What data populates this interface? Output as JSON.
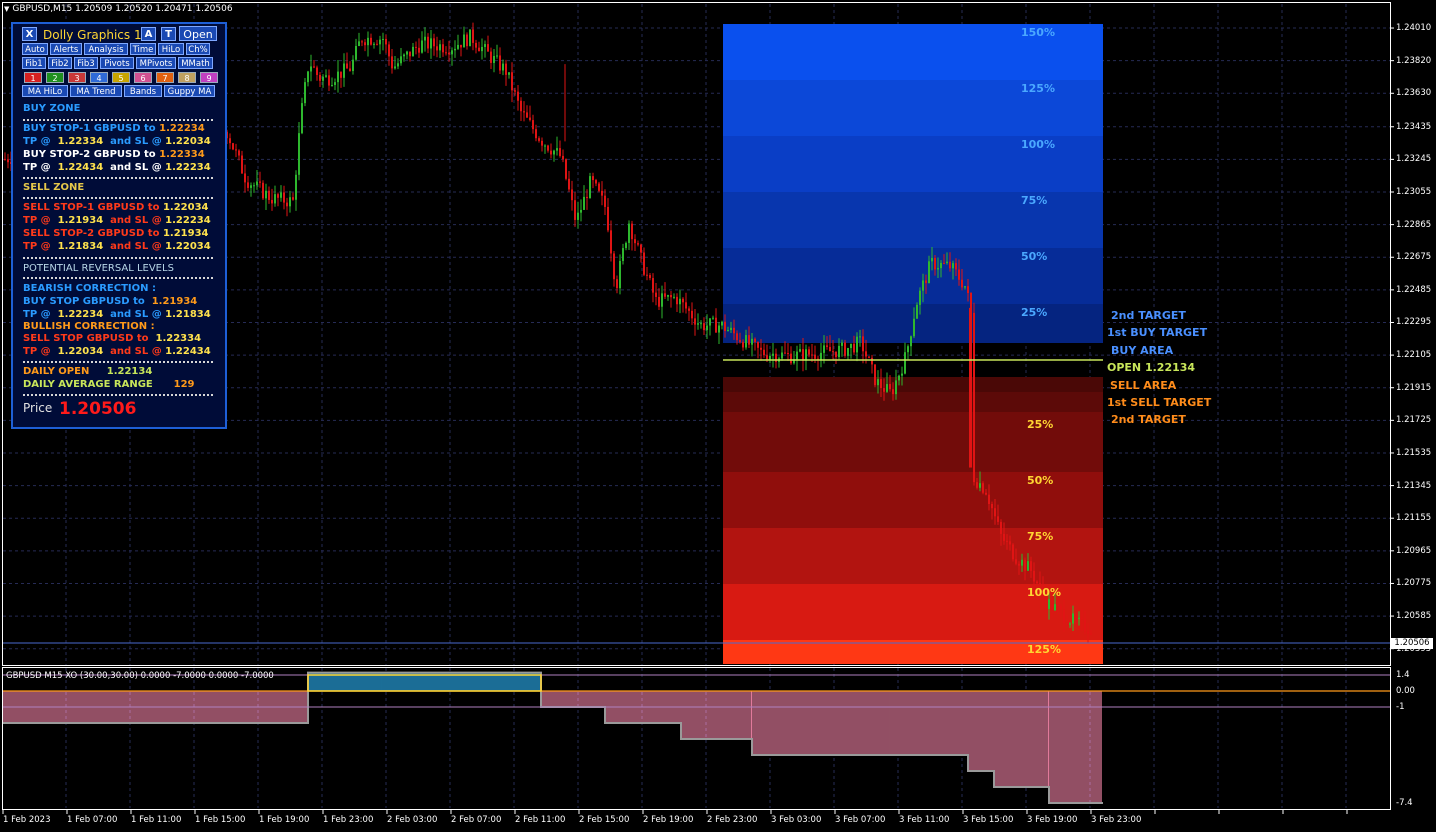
{
  "titlebar": {
    "text": "GBPUSD,M15  1.20509 1.20520 1.20471 1.20506"
  },
  "colors": {
    "bull": "#2eb82e",
    "bear": "#e01414",
    "grid": "#2a2f5a",
    "axis": "#ffffff",
    "open_line": "#c8e65a"
  },
  "panel": {
    "close": "X",
    "title": "Dolly Graphics 18",
    "a_btn": "A",
    "t_btn": "T",
    "open_btn": "Open",
    "row1": [
      "Auto",
      "Alerts",
      "Analysis",
      "Time",
      "HiLo",
      "Ch%"
    ],
    "row2": [
      "Fib1",
      "Fib2",
      "Fib3",
      "Pivots",
      "MPivots",
      "MMath"
    ],
    "row3": [
      "1",
      "2",
      "3",
      "4",
      "5",
      "6",
      "7",
      "8",
      "9"
    ],
    "row3_colors": [
      "#d62020",
      "#1f8f1f",
      "#c83838",
      "#2f6ad8",
      "#c8a400",
      "#d05090",
      "#e06010",
      "#c0a060",
      "#c040c0"
    ],
    "row4": [
      "MA HiLo",
      "MA Trend",
      "Bands",
      "Guppy MA"
    ],
    "buy_zone": "BUY ZONE",
    "buy_stop1_a": "BUY STOP-1  GBPUSD  to",
    "buy_stop1_b": "1.22234",
    "tp1_a": "TP @",
    "tp1_b": "1.22334",
    "tp1_c": "and  SL @",
    "tp1_d": "1.22034",
    "buy_stop2_a": "BUY STOP-2  GBPUSD  to",
    "buy_stop2_b": "1.22334",
    "tp2_a": "TP @",
    "tp2_b": "1.22434",
    "tp2_c": "and  SL @",
    "tp2_d": "1.22234",
    "sell_zone": "SELL ZONE",
    "sell_stop1_a": "SELL STOP-1  GBPUSD to",
    "sell_stop1_b": "1.22034",
    "stp1_a": "TP @",
    "stp1_b": "1.21934",
    "stp1_c": "and  SL @",
    "stp1_d": "1.22234",
    "sell_stop2_a": "SELL STOP-2  GBPUSD to",
    "sell_stop2_b": "1.21934",
    "stp2_a": "TP @",
    "stp2_b": "1.21834",
    "stp2_c": "and  SL @",
    "stp2_d": "1.22034",
    "potential": "POTENTIAL REVERSAL LEVELS",
    "bearish": "BEARISH CORRECTION :",
    "bear_buy_a": "BUY STOP GBPUSD  to",
    "bear_buy_b": "1.21934",
    "btp_a": "TP @",
    "btp_b": "1.22234",
    "btp_c": "and  SL @",
    "btp_d": "1.21834",
    "bullish": "BULLISH CORRECTION :",
    "bull_sell_a": "SELL STOP GBPUSD  to",
    "bull_sell_b": "1.22334",
    "ltp_a": "TP @",
    "ltp_b": "1.22034",
    "ltp_c": "and  SL @",
    "ltp_d": "1.22434",
    "daily_open_label": "DAILY OPEN",
    "daily_open_value": "1.22134",
    "dar_label": "DAILY AVERAGE RANGE",
    "dar_value": "129",
    "price_label": "Price",
    "price_value": "1.20506"
  },
  "zones": {
    "upper_levels": [
      "150%",
      "125%",
      "100%",
      "75%",
      "50%",
      "25%"
    ],
    "lower_levels": [
      "25%",
      "50%",
      "75%",
      "100%",
      "125%"
    ],
    "right_labels": {
      "buy_2nd": "2nd TARGET",
      "buy_1st": "1st BUY TARGET",
      "buy_area": "BUY AREA",
      "open": "OPEN 1.22134",
      "sell_area": "SELL AREA",
      "sell_1st": "1st SELL TARGET",
      "sell_2nd": "2nd TARGET"
    }
  },
  "price_axis": [
    "1.24010",
    "1.23820",
    "1.23630",
    "1.23435",
    "1.23245",
    "1.23055",
    "1.22865",
    "1.22675",
    "1.22485",
    "1.22295",
    "1.22105",
    "1.21915",
    "1.21725",
    "1.21535",
    "1.21345",
    "1.21155",
    "1.20965",
    "1.20775",
    "1.20585",
    "1.20395"
  ],
  "current_price_tag": "1.20506",
  "time_axis": [
    "1 Feb 2023",
    "1 Feb 07:00",
    "1 Feb 11:00",
    "1 Feb 15:00",
    "1 Feb 19:00",
    "1 Feb 23:00",
    "2 Feb 03:00",
    "2 Feb 07:00",
    "2 Feb 11:00",
    "2 Feb 15:00",
    "2 Feb 19:00",
    "2 Feb 23:00",
    "3 Feb 03:00",
    "3 Feb 07:00",
    "3 Feb 11:00",
    "3 Feb 15:00",
    "3 Feb 19:00",
    "3 Feb 23:00"
  ],
  "indicator": {
    "label": "GBPUSD M15 XO (30.00,30.00) 0.0000 -7.0000 0.0000 -7.0000",
    "axis": [
      "1.4",
      "0.00",
      "-1",
      "-7.4"
    ]
  },
  "chart_data": {
    "type": "candlestick",
    "symbol": "GBPUSD",
    "timeframe": "M15",
    "ylim": [
      1.203,
      1.2415
    ],
    "path": [
      [
        0,
        1.2324
      ],
      [
        30,
        1.2329
      ],
      [
        60,
        1.2318
      ],
      [
        90,
        1.2326
      ],
      [
        130,
        1.2317
      ],
      [
        170,
        1.2325
      ],
      [
        200,
        1.2334
      ],
      [
        225,
        1.2342
      ],
      [
        245,
        1.2313
      ],
      [
        270,
        1.2302
      ],
      [
        292,
        1.23
      ],
      [
        300,
        1.235
      ],
      [
        308,
        1.2382
      ],
      [
        318,
        1.2372
      ],
      [
        330,
        1.2372
      ],
      [
        350,
        1.2378
      ],
      [
        360,
        1.2395
      ],
      [
        382,
        1.2395
      ],
      [
        392,
        1.2378
      ],
      [
        420,
        1.2392
      ],
      [
        450,
        1.239
      ],
      [
        470,
        1.2396
      ],
      [
        490,
        1.2384
      ],
      [
        505,
        1.2376
      ],
      [
        520,
        1.2352
      ],
      [
        540,
        1.2336
      ],
      [
        560,
        1.2326
      ],
      [
        575,
        1.2288
      ],
      [
        590,
        1.2312
      ],
      [
        605,
        1.2296
      ],
      [
        615,
        1.225
      ],
      [
        628,
        1.2288
      ],
      [
        640,
        1.2266
      ],
      [
        655,
        1.2242
      ],
      [
        675,
        1.2244
      ],
      [
        700,
        1.2228
      ],
      [
        720,
        1.2228
      ],
      [
        740,
        1.222
      ],
      [
        760,
        1.2212
      ],
      [
        790,
        1.221
      ],
      [
        820,
        1.2212
      ],
      [
        845,
        1.2214
      ],
      [
        860,
        1.2218
      ],
      [
        875,
        1.2195
      ],
      [
        890,
        1.2188
      ],
      [
        905,
        1.221
      ],
      [
        915,
        1.224
      ],
      [
        930,
        1.2264
      ],
      [
        950,
        1.2262
      ],
      [
        965,
        1.225
      ],
      [
        972,
        1.2228
      ],
      [
        972,
        1.214
      ],
      [
        985,
        1.2132
      ],
      [
        1000,
        1.2105
      ],
      [
        1015,
        1.2093
      ],
      [
        1030,
        1.2085
      ],
      [
        1045,
        1.2067
      ],
      [
        1065,
        1.2058
      ],
      [
        1080,
        1.2053
      ],
      [
        1092,
        1.2051
      ]
    ]
  }
}
